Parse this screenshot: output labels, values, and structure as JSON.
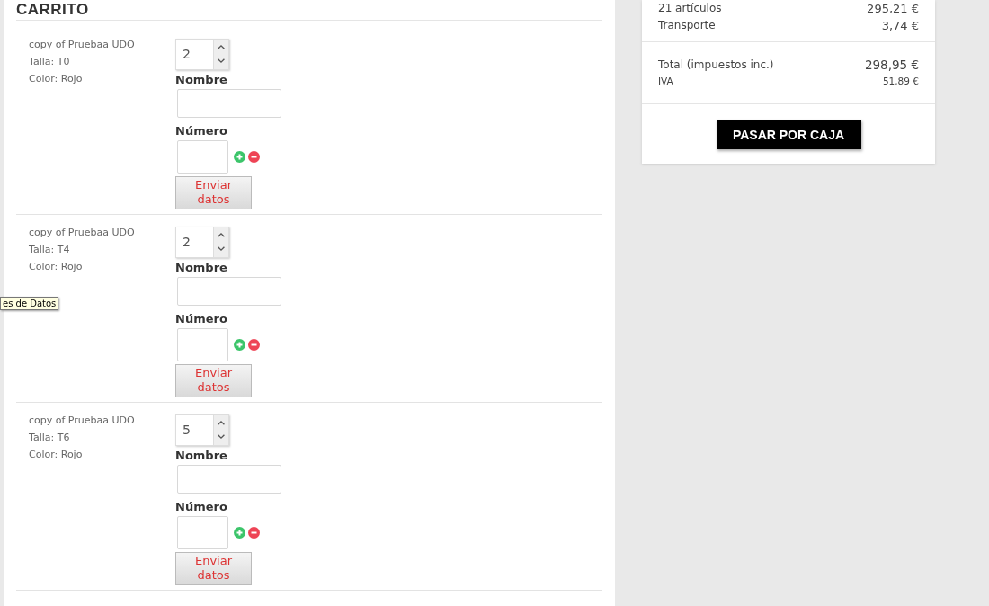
{
  "cart": {
    "title": "CARRITO",
    "items": [
      {
        "name": "copy of Pruebaa UDO",
        "size": "Talla: T0",
        "color_line": "Color: Rojo",
        "quantity": "2",
        "name_label": "Nombre",
        "number_label": "Número",
        "submit": "Enviar datos"
      },
      {
        "name": "copy of Pruebaa UDO",
        "size": "Talla: T4",
        "color_line": "Color: Rojo",
        "quantity": "2",
        "name_label": "Nombre",
        "number_label": "Número",
        "submit": "Enviar datos"
      },
      {
        "name": "copy of Pruebaa UDO",
        "size": "Talla: T6",
        "color_line": "Color: Rojo",
        "quantity": "5",
        "name_label": "Nombre",
        "number_label": "Número",
        "submit": "Enviar datos"
      }
    ]
  },
  "tooltip": "es de Datos",
  "summary": {
    "lines": [
      {
        "label": "21 artículos",
        "value": "295,21 €"
      },
      {
        "label": "Transporte",
        "value": "3,74 €"
      }
    ],
    "total": {
      "label": "Total (impuestos inc.)",
      "value": "298,95 €"
    },
    "tax": {
      "label": "IVA",
      "value": "51,89 €"
    },
    "checkout": "PASAR POR CAJA"
  }
}
